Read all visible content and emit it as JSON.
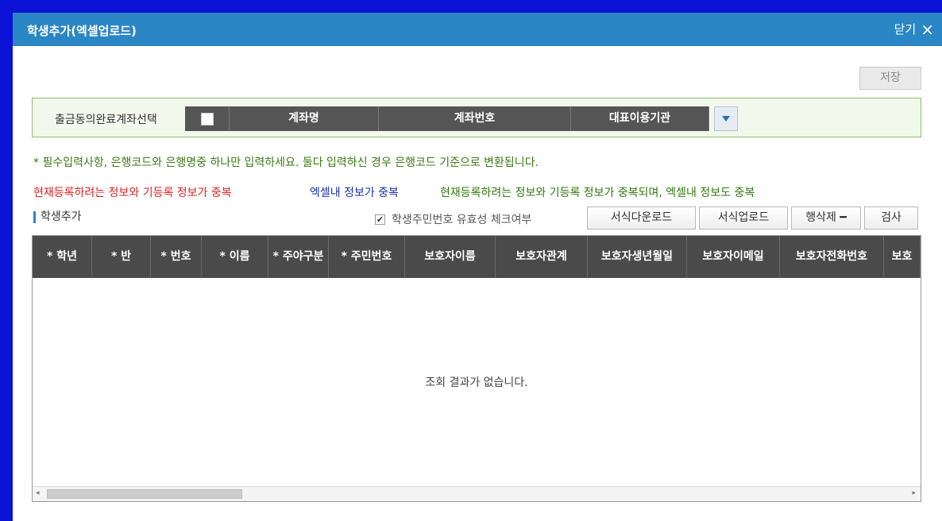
{
  "dialog": {
    "title": "학생추가(엑셀업로드)",
    "close_label": "닫기",
    "close_icon": "×"
  },
  "toolbar": {
    "save_label": "저장"
  },
  "account_select": {
    "label": "출금동의완료계좌선택",
    "columns": [
      "계좌명",
      "계좌번호",
      "대표이용기관"
    ]
  },
  "notice": "* 필수입력사항, 은행코드와 은행명중 하나만 입력하세요. 둘다 입력하신 경우 은행코드 기준으로 변환됩니다.",
  "legend": {
    "red": "현재등록하려는 정보와 기등록 정보가 중복",
    "blue": "엑셀내 정보가 중복",
    "green": "현재등록하려는 정보와 기등록 정보가 중복되며, 엑셀내 정보도 중복",
    "colors": {
      "red": "#dd2222",
      "blue": "#1a2fa8",
      "green": "#2f7a10"
    }
  },
  "section": {
    "title": "학생추가",
    "validity_check_label": "학생주민번호 유효성 체크여부",
    "validity_checked": true
  },
  "actions": {
    "download_template": "서식다운로드",
    "upload_template": "서식업로드",
    "delete_row": "행삭제 ━",
    "validate": "검사"
  },
  "grid": {
    "columns": [
      "* 학년",
      "* 반",
      "* 번호",
      "* 이름",
      "* 주야구분",
      "* 주민번호",
      "보호자이름",
      "보호자관계",
      "보호자생년월일",
      "보호자이메일",
      "보호자전화번호",
      "보호"
    ],
    "empty_message": "조회 결과가 없습니다."
  },
  "theme": {
    "titlebar_color": "#2b86c5",
    "header_color": "#4a4a4a"
  }
}
